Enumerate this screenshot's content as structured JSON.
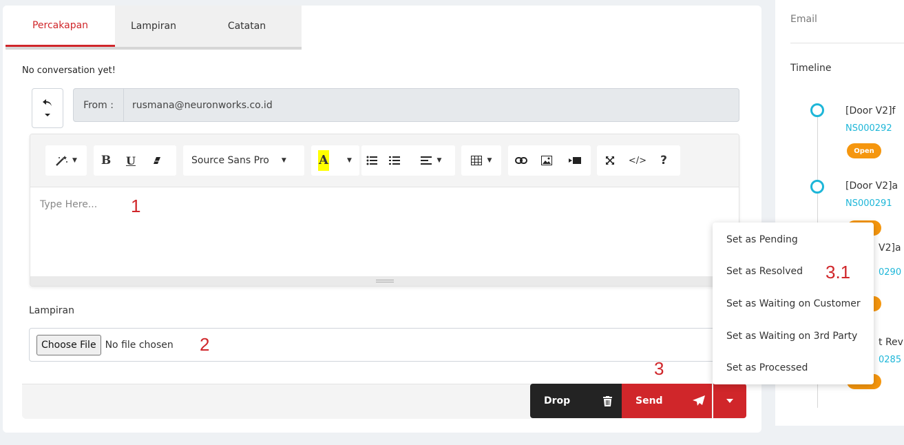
{
  "tabs": [
    {
      "label": "Percakapan",
      "active": true
    },
    {
      "label": "Lampiran",
      "active": false
    },
    {
      "label": "Catatan",
      "active": false
    }
  ],
  "conversation": {
    "empty_text": "No conversation yet!"
  },
  "from": {
    "label": "From :",
    "value": "rusmana@neuronworks.co.id"
  },
  "editor": {
    "font_name": "Source Sans Pro",
    "placeholder": "Type Here...",
    "highlight_color": "#ffff00",
    "toolbar_icons": [
      "magic-wand-icon",
      "bold-icon",
      "underline-icon",
      "eraser-icon",
      "font-color-icon",
      "unordered-list-icon",
      "ordered-list-icon",
      "align-icon",
      "table-icon",
      "link-icon",
      "image-icon",
      "video-icon",
      "fullscreen-icon",
      "code-view-icon",
      "help-icon"
    ]
  },
  "attachment": {
    "label": "Lampiran",
    "choose_label": "Choose File",
    "status": "No file chosen"
  },
  "actions": {
    "drop_label": "Drop",
    "send_label": "Send"
  },
  "annotations": {
    "a1": "1",
    "a2": "2",
    "a3": "3",
    "a31": "3.1"
  },
  "status_menu": {
    "items": [
      "Set as Pending",
      "Set as Resolved",
      "Set as Waiting on Customer",
      "Set as Waiting on 3rd Party",
      "Set as Processed"
    ]
  },
  "sidebar": {
    "email_label": "Email",
    "timeline_label": "Timeline",
    "timeline": [
      {
        "title": "[Door V2]f",
        "code": "NS000292",
        "badge": "Open"
      },
      {
        "title": "[Door V2]a",
        "code": "NS000291",
        "badge": ""
      },
      {
        "title": "V2]a",
        "code": "0290",
        "badge": ""
      },
      {
        "title": "t Rev",
        "code": "0285",
        "badge": ""
      }
    ]
  },
  "colors": {
    "accent": "#d0262a",
    "dark": "#232323",
    "timeline": "#1db6d8",
    "badge": "#f5960e"
  }
}
